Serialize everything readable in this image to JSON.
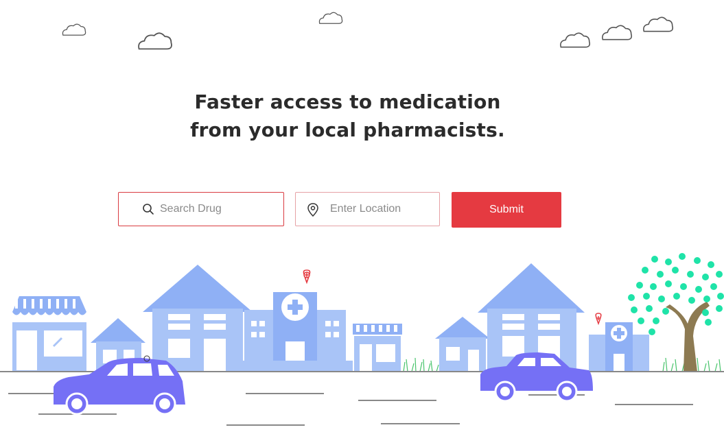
{
  "hero": {
    "line1": "Faster access to medication",
    "line2": "from your local pharmacists."
  },
  "search": {
    "drug_placeholder": "Search Drug",
    "location_placeholder": "Enter Location",
    "submit_label": "Submit"
  },
  "colors": {
    "accent": "#e53a41",
    "building": "#a9c4f7",
    "building_dark": "#8fb0f5",
    "car": "#7570f5",
    "tree_leaves": "#1fe3a8",
    "road_line": "#888888"
  },
  "icons": {
    "search": "search-icon",
    "location": "location-pin-icon",
    "cloud": "cloud-icon",
    "map_pin": "map-pin-icon"
  }
}
